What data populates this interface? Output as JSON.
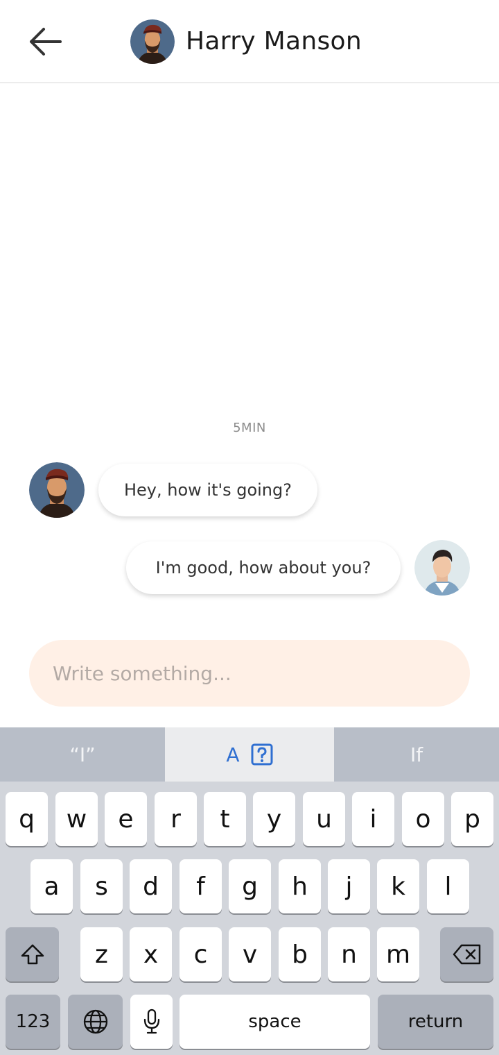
{
  "header": {
    "title": "Harry Manson",
    "back_icon": "arrow-left-icon"
  },
  "chat": {
    "timestamp": "5MIN",
    "messages": [
      {
        "sender": "Harry Manson",
        "text": "Hey, how it's going?",
        "side": "left"
      },
      {
        "sender": "me",
        "text": "I'm good, how about you?",
        "side": "right"
      }
    ]
  },
  "composer": {
    "placeholder": "Write something...",
    "value": ""
  },
  "keyboard": {
    "suggestions": [
      "“I”",
      "A",
      "If"
    ],
    "row1": [
      "q",
      "w",
      "e",
      "r",
      "t",
      "y",
      "u",
      "i",
      "o",
      "p"
    ],
    "row2": [
      "a",
      "s",
      "d",
      "f",
      "g",
      "h",
      "j",
      "k",
      "l"
    ],
    "row3": [
      "z",
      "x",
      "c",
      "v",
      "b",
      "n",
      "m"
    ],
    "numbers_label": "123",
    "space_label": "space",
    "return_label": "return"
  },
  "colors": {
    "bubble": "#ffffff",
    "composer_bg": "#fff0e6",
    "keyboard_bg": "#d2d5db",
    "suggestion_accent": "#2f6fd1"
  }
}
